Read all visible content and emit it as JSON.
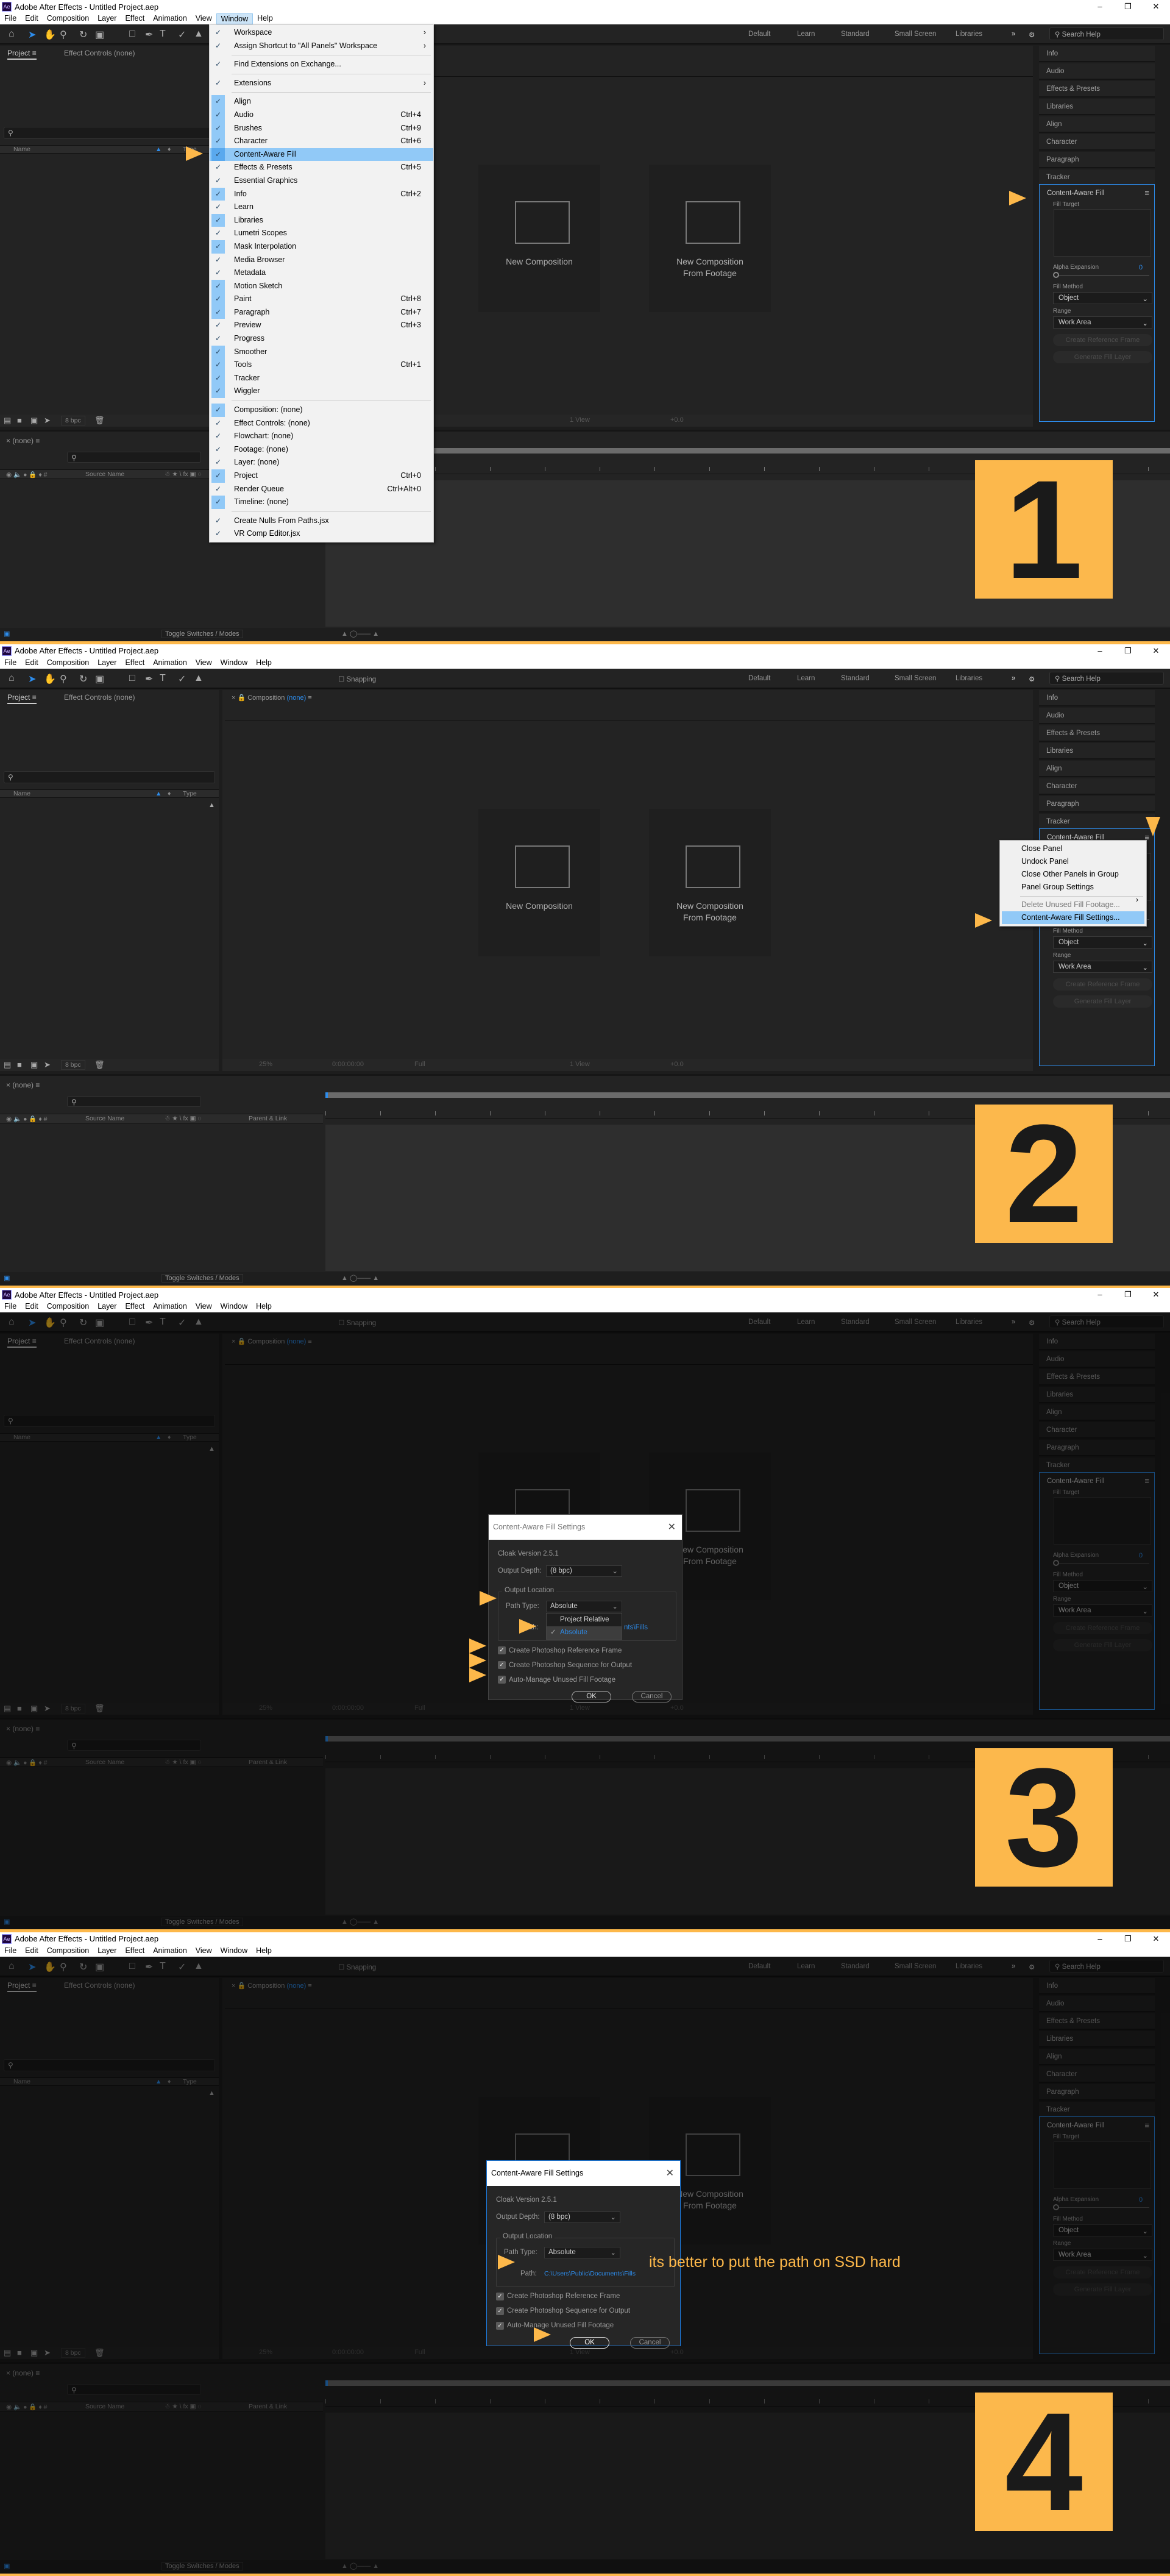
{
  "shell": {
    "title": "Adobe After Effects - Untitled Project.aep",
    "logo": "Ae",
    "window_controls": [
      "–",
      "❐",
      "✕"
    ],
    "menu": [
      "File",
      "Edit",
      "Composition",
      "Layer",
      "Effect",
      "Animation",
      "View",
      "Window",
      "Help"
    ],
    "snapping": "Snapping",
    "workspaces": [
      "Default",
      "Learn",
      "Standard",
      "Small Screen",
      "Libraries"
    ],
    "workspaces_more": "»",
    "search_help": "Search Help",
    "project_tab": "Project",
    "effect_controls_tab": "Effect Controls (none)",
    "name_col": "Name",
    "type_col": "Type",
    "bpc": "8 bpc",
    "comp_tab": "Composition",
    "comp_none": "(none)",
    "cards": [
      "New Composition",
      "New Composition\nFrom Footage"
    ],
    "viewer_bar": {
      "zoom": "25%",
      "time": "0:00:00:00",
      "resolution": "Full",
      "view": "1 View",
      "exposure": "+0.0"
    },
    "right_panels": [
      "Info",
      "Audio",
      "Effects & Presets",
      "Libraries",
      "Align",
      "Character",
      "Paragraph",
      "Tracker"
    ],
    "caf": {
      "title": "Content-Aware Fill",
      "fill_target": "Fill Target",
      "alpha_expansion": "Alpha Expansion",
      "alpha_value": "0",
      "fill_method": "Fill Method",
      "fill_method_value": "Object",
      "range": "Range",
      "range_value": "Work Area",
      "create_ref": "Create Reference Frame",
      "generate": "Generate Fill Layer"
    },
    "timeline": {
      "tab": "(none)",
      "source_name": "Source Name",
      "parent_link": "Parent & Link",
      "toggle": "Toggle Switches / Modes"
    }
  },
  "colors": {
    "accent_orange": "#fdb84a",
    "highlight_blue": "#91c9f7",
    "link_blue": "#2d8ceb"
  },
  "steps": [
    {
      "number": "1",
      "window_menu": [
        {
          "label": "Workspace",
          "sub": true
        },
        {
          "label": "Assign Shortcut to \"All Panels\" Workspace",
          "sub": true
        },
        {
          "label": "Find Extensions on Exchange...",
          "sep": true
        },
        {
          "label": "Extensions",
          "sub": true,
          "sep": true
        },
        {
          "label": "Align",
          "checked": true,
          "sep": true
        },
        {
          "label": "Audio",
          "shortcut": "Ctrl+4",
          "checked": true
        },
        {
          "label": "Brushes",
          "shortcut": "Ctrl+9",
          "checked": true
        },
        {
          "label": "Character",
          "shortcut": "Ctrl+6",
          "checked": true
        },
        {
          "label": "Content-Aware Fill",
          "checked": true,
          "hl": true
        },
        {
          "label": "Effects & Presets",
          "shortcut": "Ctrl+5"
        },
        {
          "label": "Essential Graphics"
        },
        {
          "label": "Info",
          "shortcut": "Ctrl+2",
          "checked": true
        },
        {
          "label": "Learn"
        },
        {
          "label": "Libraries",
          "checked": true
        },
        {
          "label": "Lumetri Scopes"
        },
        {
          "label": "Mask Interpolation",
          "checked": true
        },
        {
          "label": "Media Browser"
        },
        {
          "label": "Metadata"
        },
        {
          "label": "Motion Sketch",
          "checked": true
        },
        {
          "label": "Paint",
          "shortcut": "Ctrl+8",
          "checked": true
        },
        {
          "label": "Paragraph",
          "shortcut": "Ctrl+7",
          "checked": true
        },
        {
          "label": "Preview",
          "shortcut": "Ctrl+3"
        },
        {
          "label": "Progress"
        },
        {
          "label": "Smoother",
          "checked": true
        },
        {
          "label": "Tools",
          "shortcut": "Ctrl+1",
          "checked": true
        },
        {
          "label": "Tracker",
          "checked": true
        },
        {
          "label": "Wiggler",
          "checked": true
        },
        {
          "label": "Composition: (none)",
          "checked": true,
          "sep": true
        },
        {
          "label": "Effect Controls: (none)"
        },
        {
          "label": "Flowchart: (none)"
        },
        {
          "label": "Footage: (none)"
        },
        {
          "label": "Layer: (none)"
        },
        {
          "label": "Project",
          "shortcut": "Ctrl+0",
          "checked": true
        },
        {
          "label": "Render Queue",
          "shortcut": "Ctrl+Alt+0"
        },
        {
          "label": "Timeline: (none)",
          "checked": true
        },
        {
          "label": "Create Nulls From Paths.jsx",
          "sep": true
        },
        {
          "label": "VR Comp Editor.jsx"
        }
      ]
    },
    {
      "number": "2",
      "panel_menu": [
        {
          "label": "Close Panel"
        },
        {
          "label": "Undock Panel"
        },
        {
          "label": "Close Other Panels in Group"
        },
        {
          "label": "Panel Group Settings",
          "sub": true
        },
        {
          "label": "Delete Unused Fill Footage...",
          "sep": true,
          "disabled": true
        },
        {
          "label": "Content-Aware Fill Settings...",
          "hl": true
        }
      ]
    },
    {
      "number": "3"
    },
    {
      "number": "4",
      "annotation": "its better to put the path on SSD hard"
    }
  ],
  "dialog": {
    "title": "Content-Aware Fill Settings",
    "close": "✕",
    "version": "Cloak Version 2.5.1",
    "output_depth_label": "Output Depth:",
    "output_depth_value": "(8 bpc)",
    "output_location": "Output Location",
    "path_type_label": "Path Type:",
    "path_type_value": "Absolute",
    "path_type_options": [
      "Project Relative",
      "Absolute"
    ],
    "path_label": "Path:",
    "path_value": "C:\\Users\\Public\\Documents\\Fills",
    "path_value_partial": "nts\\Fills",
    "checkboxes": [
      {
        "label": "Create Photoshop Reference Frame",
        "checked": true
      },
      {
        "label": "Create Photoshop Sequence for Output",
        "checked": true
      },
      {
        "label": "Auto-Manage Unused Fill Footage",
        "checked": true
      }
    ],
    "ok": "OK",
    "cancel": "Cancel"
  }
}
